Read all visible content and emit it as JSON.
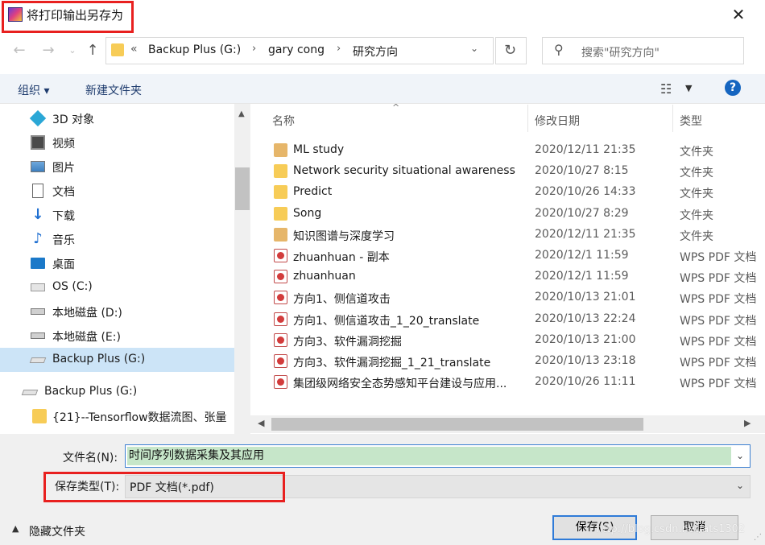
{
  "window": {
    "title": "将打印输出另存为"
  },
  "address": {
    "crumbs": [
      "«",
      "Backup Plus (G:)",
      "gary cong",
      "研究方向"
    ],
    "separator": "›"
  },
  "search": {
    "placeholder": "搜索\"研究方向\""
  },
  "toolbar": {
    "organize": "组织 ▾",
    "new_folder": "新建文件夹"
  },
  "nav": {
    "items": [
      {
        "label": "3D 对象",
        "icon": "cube-3d-icon"
      },
      {
        "label": "视频",
        "icon": "video-icon"
      },
      {
        "label": "图片",
        "icon": "pictures-icon"
      },
      {
        "label": "文档",
        "icon": "documents-icon"
      },
      {
        "label": "下载",
        "icon": "download-icon"
      },
      {
        "label": "音乐",
        "icon": "music-icon"
      },
      {
        "label": "桌面",
        "icon": "desktop-icon"
      },
      {
        "label": "OS (C:)",
        "icon": "drive-os-icon"
      },
      {
        "label": "本地磁盘 (D:)",
        "icon": "drive-icon"
      },
      {
        "label": "本地磁盘 (E:)",
        "icon": "drive-icon"
      },
      {
        "label": "Backup Plus (G:)",
        "icon": "external-drive-icon"
      },
      {
        "label": "Backup Plus (G:)",
        "icon": "external-drive-icon"
      },
      {
        "label": "{21}--Tensorflow数据流图、张量",
        "icon": "folder-icon"
      }
    ]
  },
  "columns": {
    "name": "名称",
    "date": "修改日期",
    "type": "类型"
  },
  "files": [
    {
      "name": "ML study",
      "date": "2020/12/11 21:35",
      "type": "文件夹",
      "kind": "folder-special"
    },
    {
      "name": "Network security situational awareness",
      "date": "2020/10/27 8:15",
      "type": "文件夹",
      "kind": "folder"
    },
    {
      "name": "Predict",
      "date": "2020/10/26 14:33",
      "type": "文件夹",
      "kind": "folder"
    },
    {
      "name": "Song",
      "date": "2020/10/27 8:29",
      "type": "文件夹",
      "kind": "folder"
    },
    {
      "name": "知识图谱与深度学习",
      "date": "2020/12/11 21:35",
      "type": "文件夹",
      "kind": "folder-special"
    },
    {
      "name": "zhuanhuan - 副本",
      "date": "2020/12/1 11:59",
      "type": "WPS PDF 文档",
      "kind": "pdf"
    },
    {
      "name": "zhuanhuan",
      "date": "2020/12/1 11:59",
      "type": "WPS PDF 文档",
      "kind": "pdf"
    },
    {
      "name": "方向1、侧信道攻击",
      "date": "2020/10/13 21:01",
      "type": "WPS PDF 文档",
      "kind": "pdf"
    },
    {
      "name": "方向1、侧信道攻击_1_20_translate",
      "date": "2020/10/13 22:24",
      "type": "WPS PDF 文档",
      "kind": "pdf"
    },
    {
      "name": "方向3、软件漏洞挖掘",
      "date": "2020/10/13 21:00",
      "type": "WPS PDF 文档",
      "kind": "pdf"
    },
    {
      "name": "方向3、软件漏洞挖掘_1_21_translate",
      "date": "2020/10/13 23:18",
      "type": "WPS PDF 文档",
      "kind": "pdf"
    },
    {
      "name": "集团级网络安全态势感知平台建设与应用...",
      "date": "2020/10/26 11:11",
      "type": "WPS PDF 文档",
      "kind": "pdf"
    }
  ],
  "form": {
    "filename_label": "文件名(N):",
    "filename_value": "时间序列数据采集及其应用",
    "filetype_label": "保存类型(T):",
    "filetype_value": "PDF 文档(*.pdf)"
  },
  "footer": {
    "hide_folders": "隐藏文件夹",
    "save": "保存(S)",
    "cancel": "取消",
    "watermark": "http://blog.csdn.net/ats1302"
  },
  "colors": {
    "accent": "#2f7bd8",
    "highlight": "#e8201f",
    "selection": "#cce4f7",
    "filename_fill": "#c6e6c9"
  }
}
